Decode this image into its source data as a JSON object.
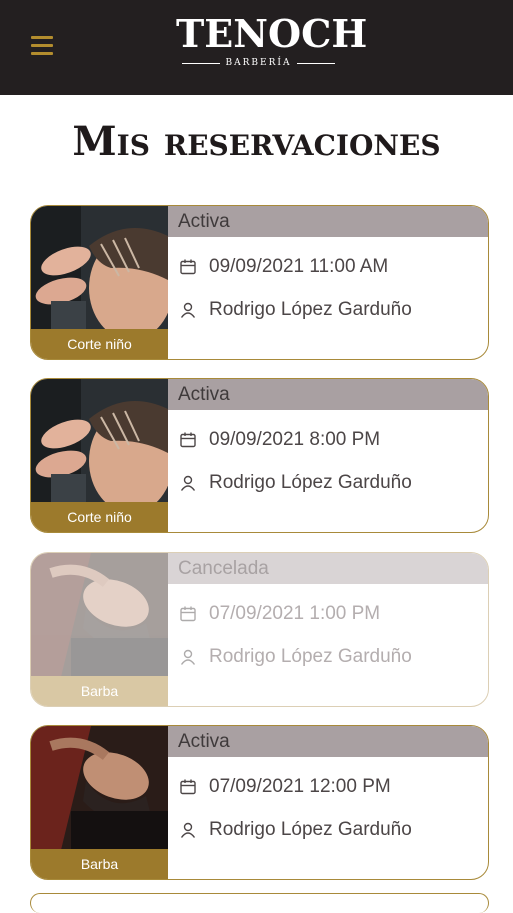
{
  "header": {
    "brand": "TENOCH",
    "brand_sub": "BARBERÍA",
    "menu_icon": "hamburger-menu-icon",
    "brand_color": "#b38d2e",
    "bar_color": "#231f20"
  },
  "page": {
    "title": "Mis reservaciones"
  },
  "reservations": [
    {
      "status": "Activa",
      "datetime": "09/09/2021 11:00 AM",
      "client": "Rodrigo López Garduño",
      "service": "Corte niño"
    },
    {
      "status": "Activa",
      "datetime": "09/09/2021 8:00 PM",
      "client": "Rodrigo López Garduño",
      "service": "Corte niño"
    },
    {
      "status": "Cancelada",
      "datetime": "07/09/2021 1:00 PM",
      "client": "Rodrigo López Garduño",
      "service": "Barba"
    },
    {
      "status": "Activa",
      "datetime": "07/09/2021 12:00 PM",
      "client": "Rodrigo López Garduño",
      "service": "Barba"
    }
  ],
  "icons": {
    "date": "calendar-icon",
    "person": "user-icon"
  },
  "colors": {
    "accent_gold": "#9c7a2c",
    "status_bar": "#a9a0a2",
    "cancelled_status": "#d9d4d5"
  }
}
